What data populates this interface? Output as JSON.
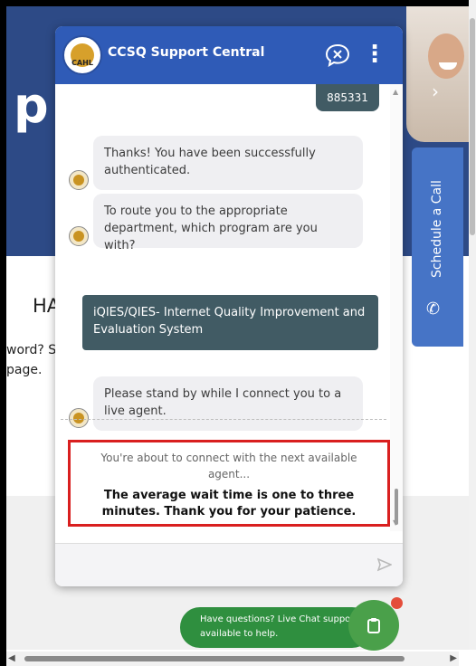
{
  "background_page": {
    "hero_letter": "p",
    "heading_fragment": "HA",
    "text_line1": "word? S",
    "text_line2": "page.",
    "schedule_call_label": "Schedule a Call"
  },
  "chat": {
    "title": "CCSQ Support Central",
    "header_logo_text": "CAHL",
    "user_message": "885331",
    "messages": [
      "Thanks! You have been successfully authenticated.",
      "To route you to the appropriate department, which program are you with?",
      "Please stand by while I connect you to a live agent."
    ],
    "selected_program": "iQIES/QIES- Internet Quality Improvement and Evaluation System",
    "notice_small": "You're about to connect with the next available agent...",
    "notice_big": "The average wait time is one to three minutes. Thank you for your patience.",
    "input_placeholder": ""
  },
  "live_chat_banner": {
    "text": "Have questions? Live Chat support is available to help."
  },
  "colors": {
    "header": "#2f5bb7",
    "user_bubble": "#415b64",
    "bot_bubble": "#efeff2",
    "highlight_border": "#d91f1f",
    "live_chat_green": "#2f8f3f",
    "schedule_tab": "#4674c6"
  }
}
